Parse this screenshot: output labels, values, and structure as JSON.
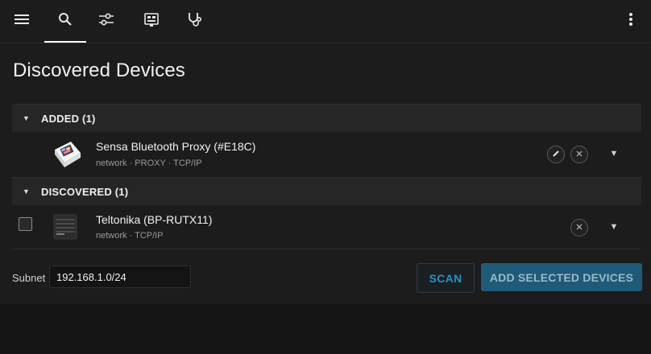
{
  "toolbar": {
    "icons": [
      "menu-icon",
      "search-icon",
      "tune-icon",
      "chip-icon",
      "stethoscope-icon"
    ],
    "active_tab": "search",
    "more_icon": "more-vert-icon"
  },
  "page": {
    "title": "Discovered Devices"
  },
  "sections": {
    "added": {
      "label": "ADDED (1)",
      "devices": [
        {
          "name": "Sensa Bluetooth Proxy (#E18C)",
          "details": "network · PROXY · TCP/IP"
        }
      ]
    },
    "discovered": {
      "label": "DISCOVERED (1)",
      "devices": [
        {
          "name": "Teltonika (BP-RUTX11)",
          "details": "network · TCP/IP",
          "selected": false
        }
      ]
    }
  },
  "footer": {
    "subnet_label": "Subnet",
    "subnet_value": "192.168.1.0/24",
    "scan_label": "SCAN",
    "add_selected_label": "ADD SELECTED DEVICES"
  },
  "colors": {
    "accent": "#2a8fc9",
    "primary_button": "#1f5a79",
    "background": "#1c1c1c"
  }
}
